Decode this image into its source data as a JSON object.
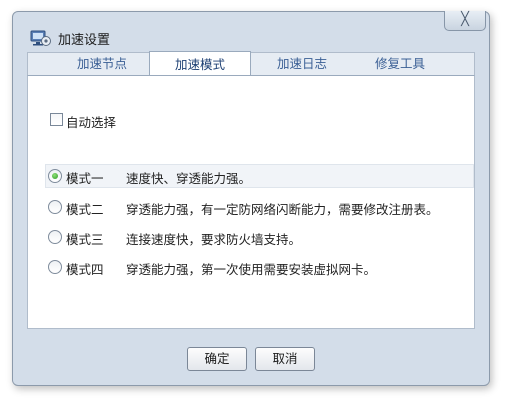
{
  "window": {
    "title": "加速设置",
    "close_glyph": "╳"
  },
  "tabs": [
    {
      "label": "加速节点",
      "active": false
    },
    {
      "label": "加速模式",
      "active": true
    },
    {
      "label": "加速日志",
      "active": false
    },
    {
      "label": "修复工具",
      "active": false
    }
  ],
  "auto_select": {
    "label": "自动选择",
    "checked": false
  },
  "modes": [
    {
      "name": "模式一",
      "desc": "速度快、穿透能力强。",
      "selected": true
    },
    {
      "name": "模式二",
      "desc": "穿透能力强，有一定防网络闪断能力，需要修改注册表。",
      "selected": false
    },
    {
      "name": "模式三",
      "desc": "连接速度快，要求防火墙支持。",
      "selected": false
    },
    {
      "name": "模式四",
      "desc": "穿透能力强，第一次使用需要安装虚拟网卡。",
      "selected": false
    }
  ],
  "buttons": {
    "ok": "确定",
    "cancel": "取消"
  },
  "colors": {
    "window_bg": "#d3dde9",
    "tab_text": "#3a5f95",
    "radio_selected": "#2e9b22"
  }
}
